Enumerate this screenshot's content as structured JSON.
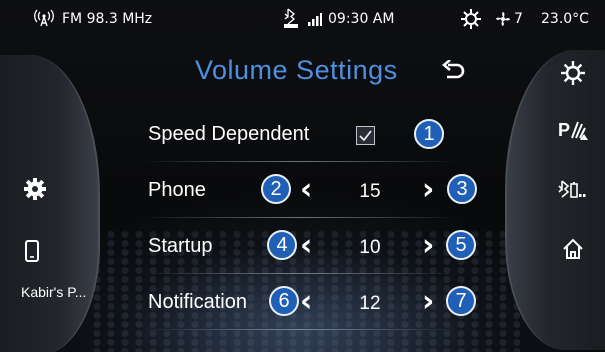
{
  "status_bar": {
    "radio": "FM 98.3 MHz",
    "time": "09:30 AM",
    "fan_level": "7",
    "temperature": "23.0°C"
  },
  "title": "Volume Settings",
  "left_sidebar": {
    "phone_name": "Kabir's P..."
  },
  "speed_dependent": {
    "label": "Speed Dependent",
    "checked": true,
    "badge": "1"
  },
  "rows": [
    {
      "label": "Phone",
      "value": "15",
      "left_badge": "2",
      "right_badge": "3"
    },
    {
      "label": "Startup",
      "value": "10",
      "left_badge": "4",
      "right_badge": "5"
    },
    {
      "label": "Notification",
      "value": "12",
      "left_badge": "6",
      "right_badge": "7"
    }
  ],
  "icons": {
    "status": [
      "radio-signal-icon",
      "bluetooth-phone-icon",
      "signal-bars-icon",
      "climate-sun-icon",
      "fan-icon"
    ],
    "left": [
      "settings-gear-icon",
      "phone-icon"
    ],
    "right": [
      "climate-sun-icon",
      "parking-sensor-icon",
      "bluetooth-battery-icon",
      "home-icon"
    ],
    "title": "back-arrow-icon"
  },
  "colors": {
    "accent": "#4e8fe0",
    "badge": "#1f5fb6"
  }
}
